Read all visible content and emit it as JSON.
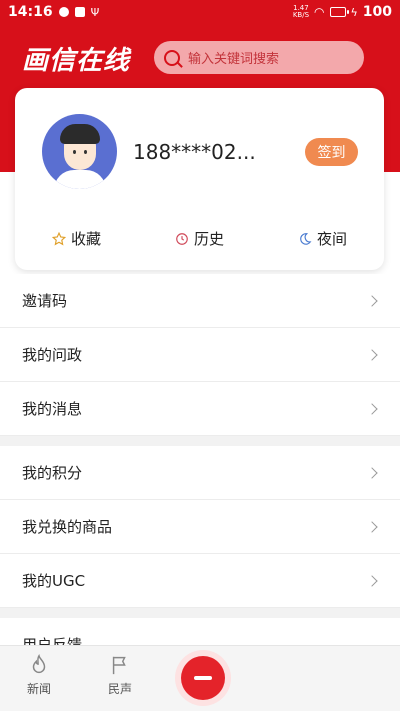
{
  "status_bar": {
    "time": "14:16",
    "net_speed_value": "1.47",
    "net_speed_unit": "KB/S",
    "battery": "100"
  },
  "header": {
    "logo_text": "画信在线",
    "search_placeholder": "输入关键词搜索"
  },
  "profile": {
    "username": "188****02...",
    "checkin_label": "签到",
    "shortcuts": [
      {
        "label": "收藏",
        "icon": "star-icon"
      },
      {
        "label": "历史",
        "icon": "clock-icon"
      },
      {
        "label": "夜间",
        "icon": "moon-icon"
      }
    ]
  },
  "menu": {
    "items": [
      {
        "label": "邀请码"
      },
      {
        "label": "我的问政"
      },
      {
        "label": "我的消息"
      },
      {
        "label": "我的积分"
      },
      {
        "label": "我兑换的商品"
      },
      {
        "label": "我的UGC"
      },
      {
        "label": "用户反馈"
      }
    ]
  },
  "bottom_nav": {
    "items": [
      {
        "label": "新闻",
        "icon": "flame-icon"
      },
      {
        "label": "民声",
        "icon": "flag-icon"
      }
    ]
  },
  "colors": {
    "brand_red": "#d7101a",
    "checkin_orange": "#f08a50"
  }
}
